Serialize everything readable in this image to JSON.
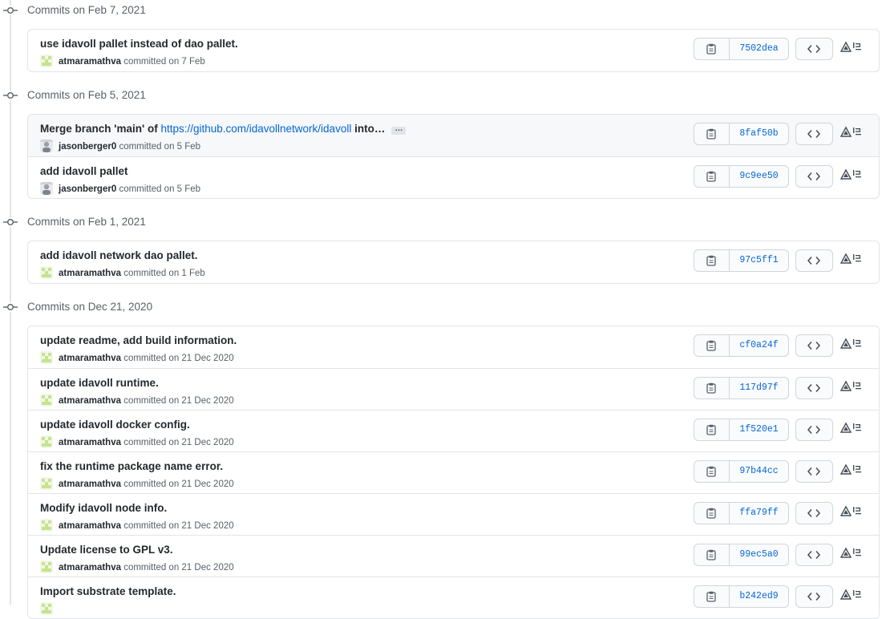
{
  "groups": [
    {
      "date_label": "Commits on Feb 7, 2021",
      "commits": [
        {
          "message": "use idavoll pallet instead of dao pallet.",
          "author": "atmaramathva",
          "committed_text": "committed on 7 Feb",
          "sha": "7502dea",
          "avatar": "identicon"
        }
      ]
    },
    {
      "date_label": "Commits on Feb 5, 2021",
      "commits": [
        {
          "message": "Merge branch 'main' of ",
          "link": "https://github.com/idavollnetwork/idavoll",
          "message_suffix": " into…",
          "ellipsis": "…",
          "author": "jasonberger0",
          "committed_text": "committed on 5 Feb",
          "sha": "8faf50b",
          "avatar": "photo",
          "highlight": true
        },
        {
          "message": "add idavoll pallet",
          "author": "jasonberger0",
          "committed_text": "committed on 5 Feb",
          "sha": "9c9ee50",
          "avatar": "photo"
        }
      ]
    },
    {
      "date_label": "Commits on Feb 1, 2021",
      "commits": [
        {
          "message": "add idavoll network dao pallet.",
          "author": "atmaramathva",
          "committed_text": "committed on 1 Feb",
          "sha": "97c5ff1",
          "avatar": "identicon"
        }
      ]
    },
    {
      "date_label": "Commits on Dec 21, 2020",
      "commits": [
        {
          "message": "update readme, add build information.",
          "author": "atmaramathva",
          "committed_text": "committed on 21 Dec 2020",
          "sha": "cf0a24f",
          "avatar": "identicon"
        },
        {
          "message": "update idavoll runtime.",
          "author": "atmaramathva",
          "committed_text": "committed on 21 Dec 2020",
          "sha": "117d97f",
          "avatar": "identicon"
        },
        {
          "message": "update idavoll docker config.",
          "author": "atmaramathva",
          "committed_text": "committed on 21 Dec 2020",
          "sha": "1f520e1",
          "avatar": "identicon"
        },
        {
          "message": "fix the runtime package name error.",
          "author": "atmaramathva",
          "committed_text": "committed on 21 Dec 2020",
          "sha": "97b44cc",
          "avatar": "identicon"
        },
        {
          "message": "Modify idavoll node info.",
          "author": "atmaramathva",
          "committed_text": "committed on 21 Dec 2020",
          "sha": "ffa79ff",
          "avatar": "identicon"
        },
        {
          "message": "Update license to GPL v3.",
          "author": "atmaramathva",
          "committed_text": "committed on 21 Dec 2020",
          "sha": "99ec5a0",
          "avatar": "identicon"
        },
        {
          "message": "Import substrate template.",
          "author": "",
          "committed_text": "",
          "sha": "b242ed9",
          "avatar": "identicon"
        }
      ]
    }
  ],
  "icons": {
    "commit": "git-commit-icon",
    "copy": "clipboard-icon",
    "browse": "code-icon",
    "extension": "extension-icon"
  },
  "colors": {
    "link": "#0366d6",
    "text": "#24292e",
    "muted": "#586069",
    "border": "#e1e4e8",
    "identicon": "#c6e48b"
  }
}
